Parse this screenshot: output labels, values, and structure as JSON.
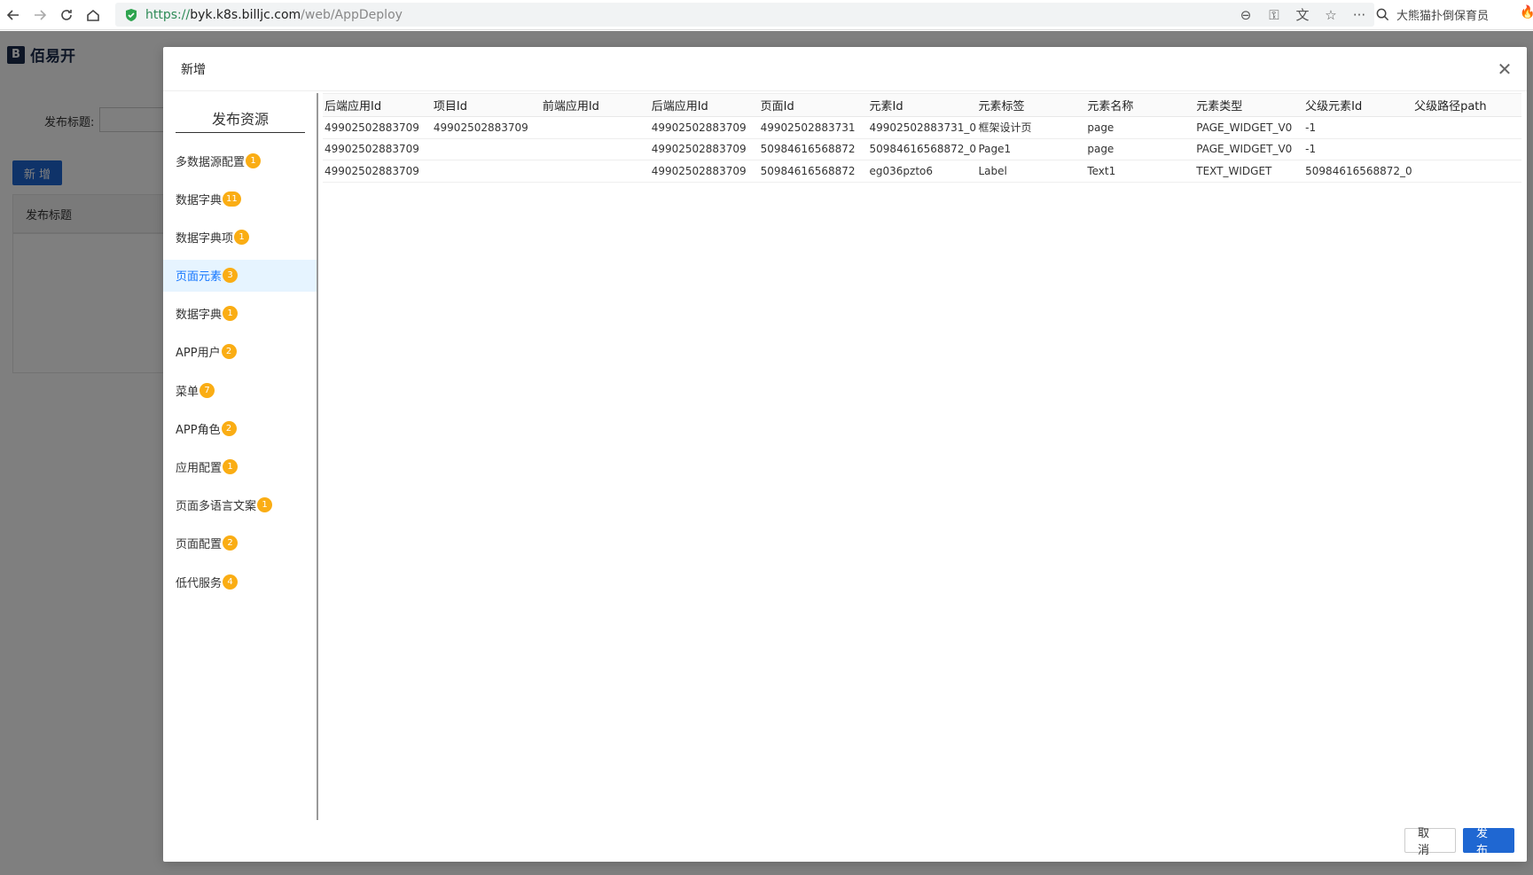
{
  "browser": {
    "url_scheme": "https://",
    "url_host": "byk.k8s.billjc.com",
    "url_path": "/web/AppDeploy",
    "search_text": "大熊猫扑倒保育员",
    "icons": [
      "back-icon",
      "forward-icon",
      "reload-icon",
      "home-icon",
      "shield-icon",
      "zoom-icon",
      "key-icon",
      "translate-icon",
      "star-icon",
      "more-icon",
      "search-icon"
    ]
  },
  "app": {
    "logo_text": "佰易开",
    "filter_label": "发布标题:",
    "add_button": "新 增",
    "table_header": "发布标题"
  },
  "modal": {
    "title": "新增",
    "sidebar_title": "发布资源",
    "items": [
      {
        "label": "多数据源配置",
        "count": "1"
      },
      {
        "label": "数据字典",
        "count": "11"
      },
      {
        "label": "数据字典项",
        "count": "1"
      },
      {
        "label": "页面元素",
        "count": "3"
      },
      {
        "label": "数据字典",
        "count": "1"
      },
      {
        "label": "APP用户",
        "count": "2"
      },
      {
        "label": "菜单",
        "count": "7"
      },
      {
        "label": "APP角色",
        "count": "2"
      },
      {
        "label": "应用配置",
        "count": "1"
      },
      {
        "label": "页面多语言文案",
        "count": "1"
      },
      {
        "label": "页面配置",
        "count": "2"
      },
      {
        "label": "低代服务",
        "count": "4"
      }
    ],
    "active_index": 3,
    "columns": [
      "后端应用Id",
      "项目Id",
      "前端应用Id",
      "后端应用Id",
      "页面Id",
      "元素Id",
      "元素标签",
      "元素名称",
      "元素类型",
      "父级元素Id",
      "父级路径path"
    ],
    "rows": [
      [
        "49902502883709",
        "49902502883709",
        "",
        "49902502883709",
        "49902502883731",
        "49902502883731_0",
        "框架设计页",
        "page",
        "PAGE_WIDGET_V0",
        "-1",
        ""
      ],
      [
        "49902502883709",
        "",
        "",
        "49902502883709",
        "50984616568872",
        "50984616568872_0",
        "Page1",
        "page",
        "PAGE_WIDGET_V0",
        "-1",
        ""
      ],
      [
        "49902502883709",
        "",
        "",
        "49902502883709",
        "50984616568872",
        "eg036pzto6",
        "Label",
        "Text1",
        "TEXT_WIDGET",
        "50984616568872_0",
        ""
      ]
    ],
    "cancel_label": "取 消",
    "publish_label": "发 布"
  }
}
